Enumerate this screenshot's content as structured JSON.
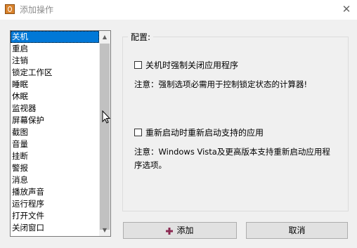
{
  "window": {
    "title": "添加操作",
    "close_glyph": "✕",
    "icon": "app-icon"
  },
  "action_list": {
    "selected": "关机",
    "items": [
      "关机",
      "重启",
      "注销",
      "锁定工作区",
      "睡眠",
      "休眠",
      "监视器",
      "屏幕保护",
      "截图",
      "音量",
      "挂断",
      "警报",
      "消息",
      "播放声音",
      "运行程序",
      "打开文件",
      "关闭窗口"
    ]
  },
  "config": {
    "legend": "配置:",
    "force_close": {
      "label": "关机时强制关闭应用程序",
      "checked": false,
      "note": "注意：强制选项必需用于控制锁定状态的计算器!"
    },
    "restart_apps": {
      "label": "重新启动时重新启动支持的应用",
      "checked": false,
      "note": "注意：Windows Vista及更高版本支持重新启动应用程序选项。"
    }
  },
  "buttons": {
    "add_label": "添加",
    "cancel_label": "取消"
  },
  "colors": {
    "selection": "#0078d7",
    "add_icon": "#8b2a52"
  }
}
